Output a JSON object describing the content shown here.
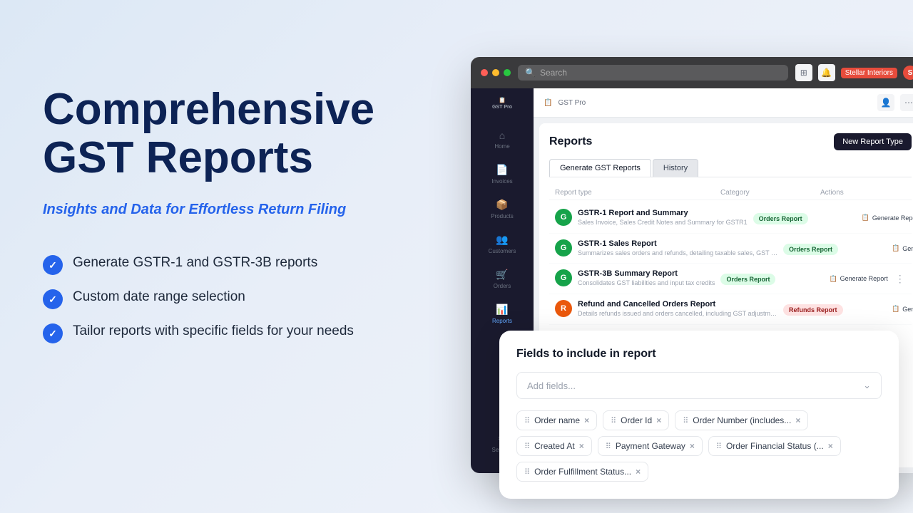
{
  "background": {
    "gradient_start": "#dce8f5",
    "gradient_end": "#f0f4fa"
  },
  "left_panel": {
    "title_line1": "Comprehensive",
    "title_line2": "GST Reports",
    "subtitle": "Insights and Data for Effortless Return Filing",
    "features": [
      {
        "id": "f1",
        "text": "Generate GSTR-1 and GSTR-3B reports"
      },
      {
        "id": "f2",
        "text": "Custom date range selection"
      },
      {
        "id": "f3",
        "text": "Tailor reports with specific fields for your needs"
      }
    ]
  },
  "browser": {
    "search_placeholder": "Search",
    "store_name": "Stellar Interiors"
  },
  "sidebar": {
    "logo": "GST Pro",
    "items": [
      {
        "id": "home",
        "label": "Home",
        "icon": "⌂"
      },
      {
        "id": "invoices",
        "label": "Invoices",
        "icon": "📄"
      },
      {
        "id": "products",
        "label": "Products",
        "icon": "📦"
      },
      {
        "id": "customers",
        "label": "Customers",
        "icon": "👥"
      },
      {
        "id": "orders",
        "label": "Orders",
        "icon": "🛒"
      },
      {
        "id": "reports",
        "label": "Reports",
        "icon": "📊",
        "active": true
      }
    ],
    "bottom_items": [
      {
        "id": "settings",
        "label": "Settings",
        "icon": "⚙"
      }
    ]
  },
  "app_topbar": {
    "logo_text": "GST Pro",
    "app_name": "GST Pro",
    "icon1": "👤",
    "icon2": "⋯"
  },
  "reports_panel": {
    "title": "Reports",
    "new_button": "New Report Type",
    "tabs": [
      {
        "id": "generate",
        "label": "Generate GST Reports",
        "active": true
      },
      {
        "id": "history",
        "label": "History",
        "active": false
      }
    ],
    "table_headers": [
      "Report type",
      "Category",
      "Actions"
    ],
    "rows": [
      {
        "id": "r1",
        "icon_letter": "G",
        "icon_color": "green",
        "name": "GSTR-1 Report and Summary",
        "description": "Sales Invoice, Sales Credit Notes and Summary for GSTR1",
        "category": "Orders Report",
        "category_type": "orders",
        "action": "Generate Report"
      },
      {
        "id": "r2",
        "icon_letter": "G",
        "icon_color": "green",
        "name": "GSTR-1 Sales Report",
        "description": "Summarizes sales orders and refunds, detailing taxable sales, GST collected, and adju...",
        "category": "Orders Report",
        "category_type": "orders",
        "action": "Generate Report"
      },
      {
        "id": "r3",
        "icon_letter": "G",
        "icon_color": "green",
        "name": "GSTR-3B Summary Report",
        "description": "Consolidates GST liabilities and input tax credits",
        "category": "Orders Report",
        "category_type": "orders",
        "action": "Generate Report"
      },
      {
        "id": "r4",
        "icon_letter": "R",
        "icon_color": "orange",
        "name": "Refund and Cancelled Orders Report",
        "description": "Details refunds issued and orders cancelled, including GST adjustments, to track return...",
        "category": "Refunds Report",
        "category_type": "refunds",
        "action": "Generate Report"
      }
    ]
  },
  "fields_modal": {
    "title": "Fields to include in report",
    "input_placeholder": "Add fields...",
    "tags": [
      {
        "id": "order_name",
        "label": "Order name"
      },
      {
        "id": "order_id",
        "label": "Order Id"
      },
      {
        "id": "order_number",
        "label": "Order Number (includes..."
      },
      {
        "id": "created_at",
        "label": "Created At"
      },
      {
        "id": "payment_gateway",
        "label": "Payment Gateway"
      },
      {
        "id": "order_financial_status",
        "label": "Order Financial Status (..."
      },
      {
        "id": "order_fulfillment",
        "label": "Order Fulfillment Status..."
      }
    ]
  }
}
